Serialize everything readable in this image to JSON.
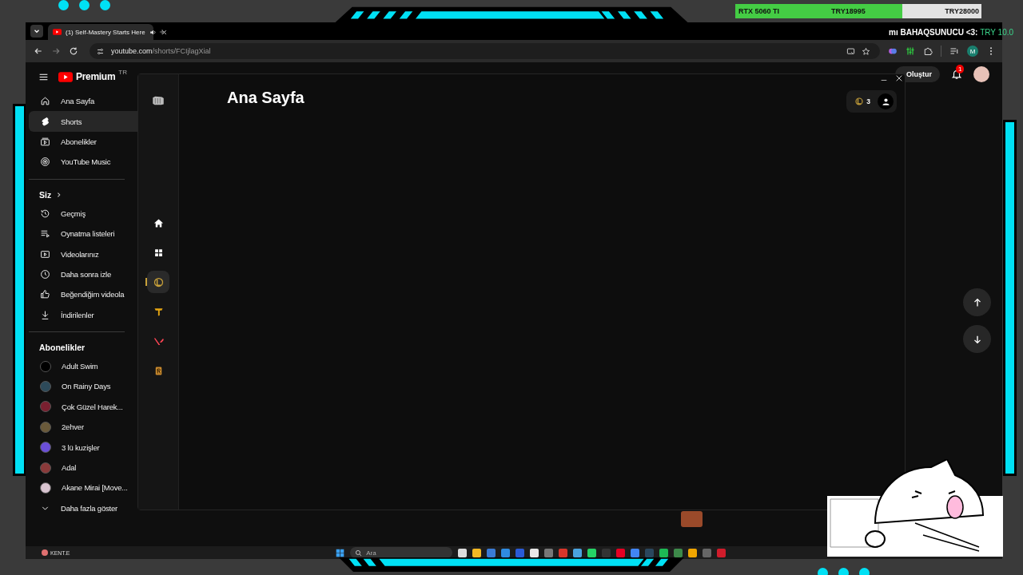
{
  "stream_overlay": {
    "goal": {
      "item": "RTX 5060 TI",
      "current": "TRY18995",
      "target": "TRY28000",
      "level": 0.68
    },
    "ticker": {
      "name": "mı BAHAQSUNUCU <3:",
      "amount": "TRY 10.0"
    }
  },
  "browser": {
    "tabs": [
      {
        "title": "(1) Self-Mastery Starts Here",
        "selected": true,
        "audio": true
      }
    ],
    "url": {
      "host": "youtube.com",
      "path": "/shorts/FCIjlagXial"
    },
    "profile_initial": "M"
  },
  "youtube": {
    "logo": "Premium",
    "region": "TR",
    "create": "Oluştur",
    "notifications": "1",
    "nav": [
      {
        "label": "Ana Sayfa",
        "selected": false
      },
      {
        "label": "Shorts",
        "selected": true
      },
      {
        "label": "Abonelikler",
        "selected": false
      },
      {
        "label": "YouTube Music",
        "selected": false
      }
    ],
    "you": {
      "title": "Siz",
      "items": [
        {
          "label": "Geçmiş",
          "selected": false
        },
        {
          "label": "Oynatma listeleri",
          "selected": false
        },
        {
          "label": "Videolarınız",
          "selected": false
        },
        {
          "label": "Daha sonra izle",
          "selected": false
        },
        {
          "label": "Beğendiğim videola",
          "selected": false
        },
        {
          "label": "İndirilenler",
          "selected": false
        }
      ]
    },
    "subscriptions": {
      "title": "Abonelikler",
      "channels": [
        {
          "name": "Adult Swim"
        },
        {
          "name": "On Rainy Days"
        },
        {
          "name": "Çok Güzel Harek..."
        },
        {
          "name": "2ehver"
        },
        {
          "name": "3 lü kuzişler"
        },
        {
          "name": "Adal"
        },
        {
          "name": "Akane Mirai [Move..."
        }
      ],
      "more": "Daha fazla göster"
    }
  },
  "panel": {
    "title": "Ana Sayfa",
    "coins": "3",
    "rail": [
      {
        "kind": "home",
        "selected": false
      },
      {
        "kind": "grid",
        "selected": false
      },
      {
        "kind": "league",
        "selected": true
      },
      {
        "kind": "tactics",
        "selected": false
      },
      {
        "kind": "valorant",
        "selected": false
      },
      {
        "kind": "runeterra",
        "selected": false
      }
    ]
  },
  "taskbar": {
    "widget": "KENT.E",
    "search": "Ara"
  }
}
